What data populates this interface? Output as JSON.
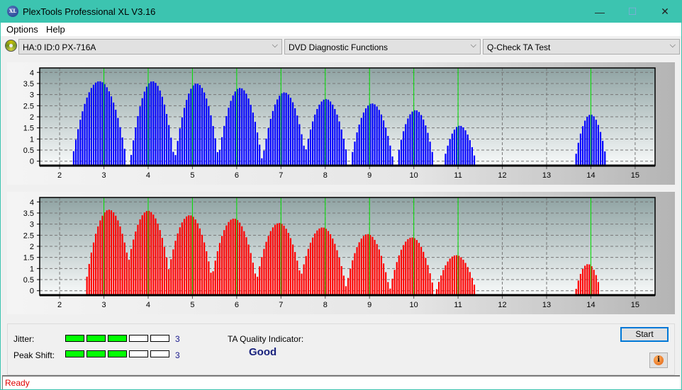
{
  "window": {
    "title": "PlexTools Professional XL V3.16",
    "app_icon": "XL",
    "controls": {
      "minimize": "—",
      "maximize": "☐",
      "close": "✕"
    }
  },
  "menu": [
    {
      "label": "Options"
    },
    {
      "label": "Help"
    }
  ],
  "toolbar": {
    "drive_combo": "HA:0 ID:0  PX-716A",
    "function_combo": "DVD Diagnostic Functions",
    "test_combo": "Q-Check TA Test",
    "chevron": "⌵"
  },
  "chart_data": [
    {
      "type": "bar",
      "name": "land-histogram",
      "color": "#0000ff",
      "xlim": [
        1.55,
        15.45
      ],
      "ylim": [
        -0.2,
        4.2
      ],
      "x_ticks": [
        "2",
        "3",
        "4",
        "5",
        "6",
        "7",
        "8",
        "9",
        "10",
        "11",
        "12",
        "13",
        "14",
        "15"
      ],
      "y_ticks": [
        "0",
        "0.5",
        "1",
        "1.5",
        "2",
        "2.5",
        "3",
        "3.5",
        "4"
      ],
      "reference_lines": [
        3,
        4,
        5,
        6,
        7,
        8,
        9,
        10,
        11,
        14
      ],
      "bin_width": 0.05,
      "peaks": [
        {
          "center": 2.88,
          "height": 3.6,
          "halfwidth": 0.62
        },
        {
          "center": 4.08,
          "height": 3.6,
          "halfwidth": 0.5
        },
        {
          "center": 5.08,
          "height": 3.5,
          "halfwidth": 0.5
        },
        {
          "center": 6.06,
          "height": 3.3,
          "halfwidth": 0.5
        },
        {
          "center": 7.06,
          "height": 3.1,
          "halfwidth": 0.5
        },
        {
          "center": 8.0,
          "height": 2.8,
          "halfwidth": 0.5
        },
        {
          "center": 9.04,
          "height": 2.6,
          "halfwidth": 0.48
        },
        {
          "center": 10.02,
          "height": 2.3,
          "halfwidth": 0.42
        },
        {
          "center": 11.02,
          "height": 1.6,
          "halfwidth": 0.36
        },
        {
          "center": 13.98,
          "height": 2.1,
          "halfwidth": 0.36
        }
      ]
    },
    {
      "type": "bar",
      "name": "pit-histogram",
      "color": "#ff0000",
      "xlim": [
        1.55,
        15.45
      ],
      "ylim": [
        -0.2,
        4.2
      ],
      "x_ticks": [
        "2",
        "3",
        "4",
        "5",
        "6",
        "7",
        "8",
        "9",
        "10",
        "11",
        "12",
        "13",
        "14",
        "15"
      ],
      "y_ticks": [
        "0",
        "0.5",
        "1",
        "1.5",
        "2",
        "2.5",
        "3",
        "3.5",
        "4"
      ],
      "reference_lines": [
        3,
        4,
        5,
        6,
        7,
        8,
        9,
        10,
        11,
        14
      ],
      "bin_width": 0.05,
      "peaks": [
        {
          "center": 3.1,
          "height": 3.65,
          "halfwidth": 0.55
        },
        {
          "center": 3.98,
          "height": 3.6,
          "halfwidth": 0.55
        },
        {
          "center": 4.92,
          "height": 3.4,
          "halfwidth": 0.55
        },
        {
          "center": 5.92,
          "height": 3.25,
          "halfwidth": 0.55
        },
        {
          "center": 6.94,
          "height": 3.05,
          "halfwidth": 0.55
        },
        {
          "center": 7.92,
          "height": 2.85,
          "halfwidth": 0.55
        },
        {
          "center": 8.94,
          "height": 2.55,
          "halfwidth": 0.5
        },
        {
          "center": 9.94,
          "height": 2.4,
          "halfwidth": 0.5
        },
        {
          "center": 10.94,
          "height": 1.6,
          "halfwidth": 0.45
        },
        {
          "center": 13.92,
          "height": 1.2,
          "halfwidth": 0.28
        }
      ]
    }
  ],
  "metrics": {
    "jitter": {
      "label": "Jitter:",
      "value": "3",
      "level": 3,
      "max": 5
    },
    "peak_shift": {
      "label": "Peak Shift:",
      "value": "3",
      "level": 3,
      "max": 5
    },
    "ta_quality_label": "TA Quality Indicator:",
    "ta_quality_value": "Good"
  },
  "buttons": {
    "start": "Start",
    "info": "i"
  },
  "status": "Ready"
}
